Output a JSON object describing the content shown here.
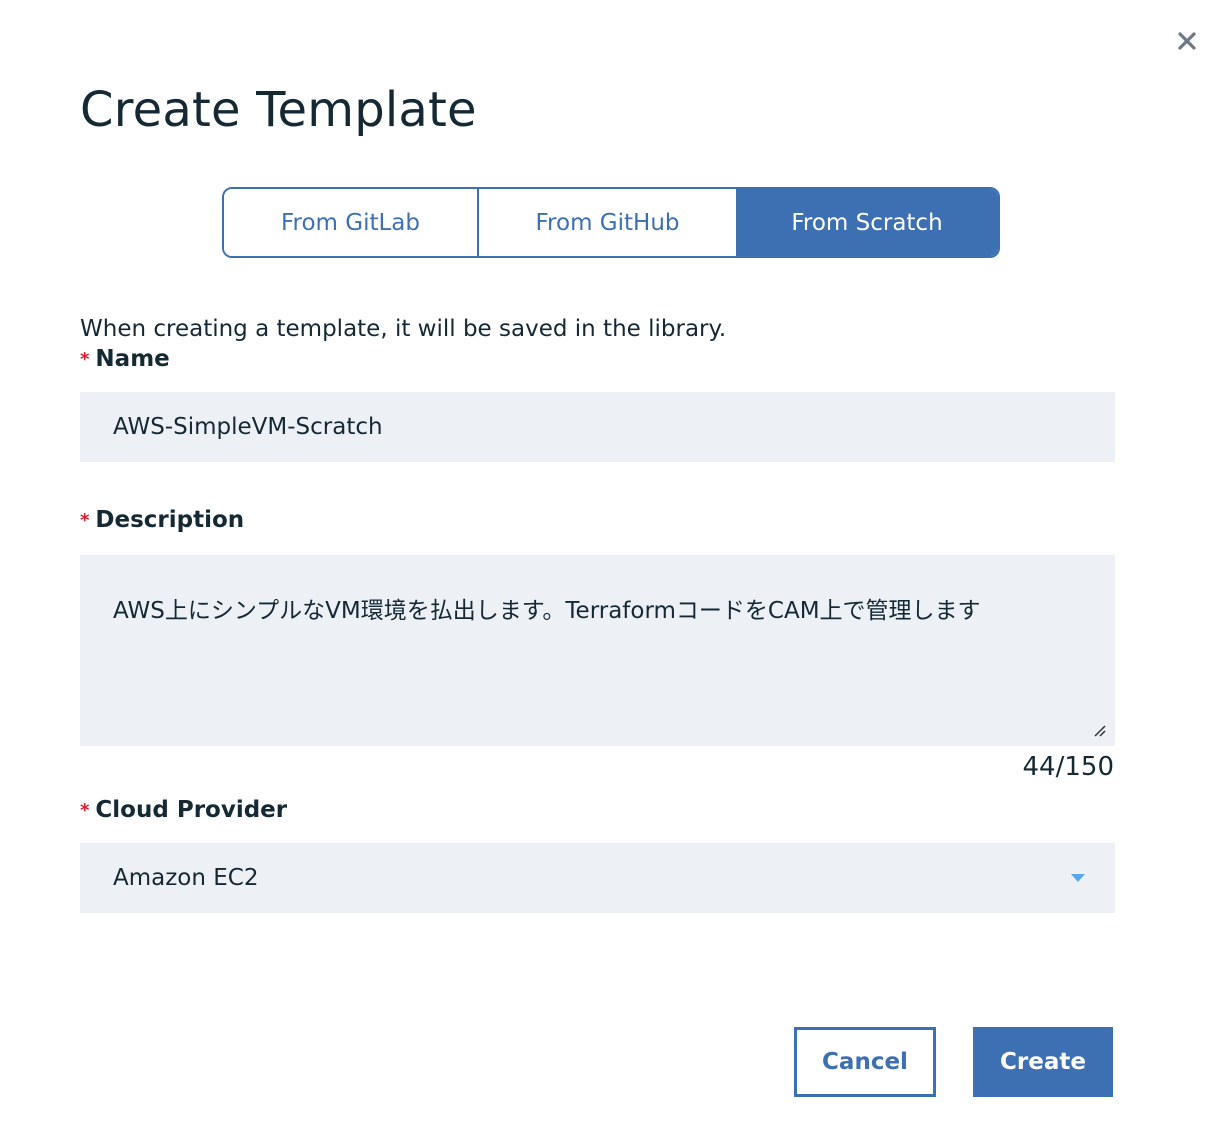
{
  "dialog": {
    "title": "Create Template",
    "close_icon": "close-icon"
  },
  "source_tabs": {
    "items": [
      {
        "label": "From GitLab",
        "selected": false
      },
      {
        "label": "From GitHub",
        "selected": false
      },
      {
        "label": "From Scratch",
        "selected": true
      }
    ]
  },
  "intro_text": "When creating a template, it will be saved in the library.",
  "form": {
    "required_mark": "*",
    "name": {
      "label": "Name",
      "value": "AWS-SimpleVM-Scratch"
    },
    "description": {
      "label": "Description",
      "value": "AWS上にシンプルなVM環境を払出します。TerraformコードをCAM上で管理します",
      "counter": "44/150"
    },
    "cloud_provider": {
      "label": "Cloud Provider",
      "selected": "Amazon EC2"
    }
  },
  "actions": {
    "cancel_label": "Cancel",
    "create_label": "Create"
  },
  "colors": {
    "accent": "#3d70b2",
    "field_bg": "#edf1f6",
    "required": "#e0182d",
    "text": "#152935",
    "dropdown_arrow": "#5aa7f0"
  }
}
